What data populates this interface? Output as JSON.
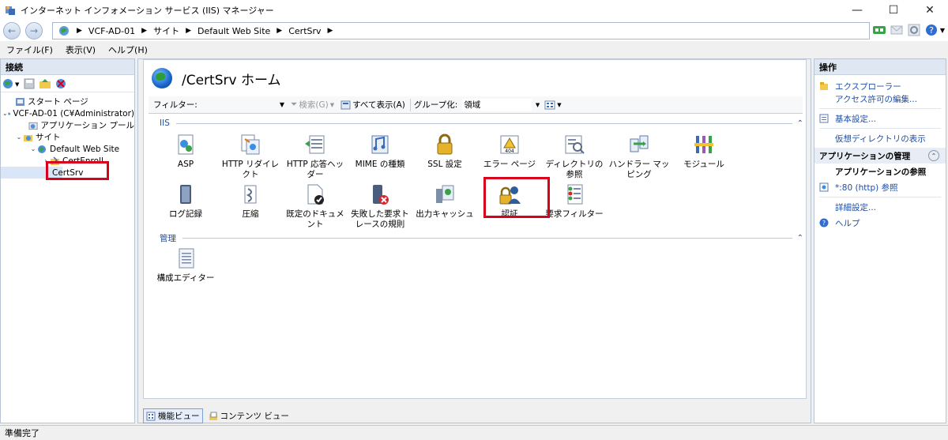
{
  "window": {
    "title": "インターネット インフォメーション サービス (IIS) マネージャー",
    "controls": [
      "—",
      "☐",
      "✕"
    ]
  },
  "address": {
    "crumbs": [
      "VCF-AD-01",
      "サイト",
      "Default Web Site",
      "CertSrv"
    ]
  },
  "menu": [
    "ファイル(F)",
    "表示(V)",
    "ヘルプ(H)"
  ],
  "connections": {
    "header": "接続",
    "tree": [
      {
        "label": "スタート ページ",
        "level": 0,
        "toggle": ""
      },
      {
        "label": "VCF-AD-01 (C¥Administrator)",
        "level": 0,
        "toggle": "⌄"
      },
      {
        "label": "アプリケーション プール",
        "level": 1,
        "toggle": ""
      },
      {
        "label": "サイト",
        "level": 1,
        "toggle": "⌄"
      },
      {
        "label": "Default Web Site",
        "level": 2,
        "toggle": "⌄"
      },
      {
        "label": "CertEnroll",
        "level": 3,
        "toggle": "›"
      },
      {
        "label": "CertSrv",
        "level": 3,
        "toggle": ""
      }
    ]
  },
  "home": {
    "title": "/CertSrv ホーム"
  },
  "filterbar": {
    "filter_label": "フィルター:",
    "search_label": "検索(G)",
    "show_all_label": "すべて表示(A)",
    "group_label": "グループ化:",
    "group_value": "領域"
  },
  "groups": {
    "iis": "IIS",
    "manage": "管理"
  },
  "features_iis": [
    {
      "label": "ASP"
    },
    {
      "label": "HTTP リダイレクト"
    },
    {
      "label": "HTTP 応答ヘッダー"
    },
    {
      "label": "MIME の種類"
    },
    {
      "label": "SSL 設定"
    },
    {
      "label": "エラー ページ"
    },
    {
      "label": "ディレクトリの参照"
    },
    {
      "label": "ハンドラー マッピング"
    },
    {
      "label": "モジュール"
    },
    {
      "label": "ログ記録"
    },
    {
      "label": "圧縮"
    },
    {
      "label": "既定のドキュメント"
    },
    {
      "label": "失敗した要求トレースの規則"
    },
    {
      "label": "出力キャッシュ"
    },
    {
      "label": "認証"
    },
    {
      "label": "要求フィルター"
    }
  ],
  "features_manage": [
    {
      "label": "構成エディター"
    }
  ],
  "views": {
    "features": "機能ビュー",
    "content": "コンテンツ ビュー"
  },
  "actions": {
    "header": "操作",
    "explore": "エクスプローラー",
    "edit_permissions": "アクセス許可の編集...",
    "basic_settings": "基本設定...",
    "view_vdirs": "仮想ディレクトリの表示",
    "manage_app_section": "アプリケーションの管理",
    "browse_app": "アプリケーションの参照",
    "browse_80": "*:80 (http) 参照",
    "advanced": "詳細設定...",
    "help": "ヘルプ"
  },
  "status": "準備完了"
}
